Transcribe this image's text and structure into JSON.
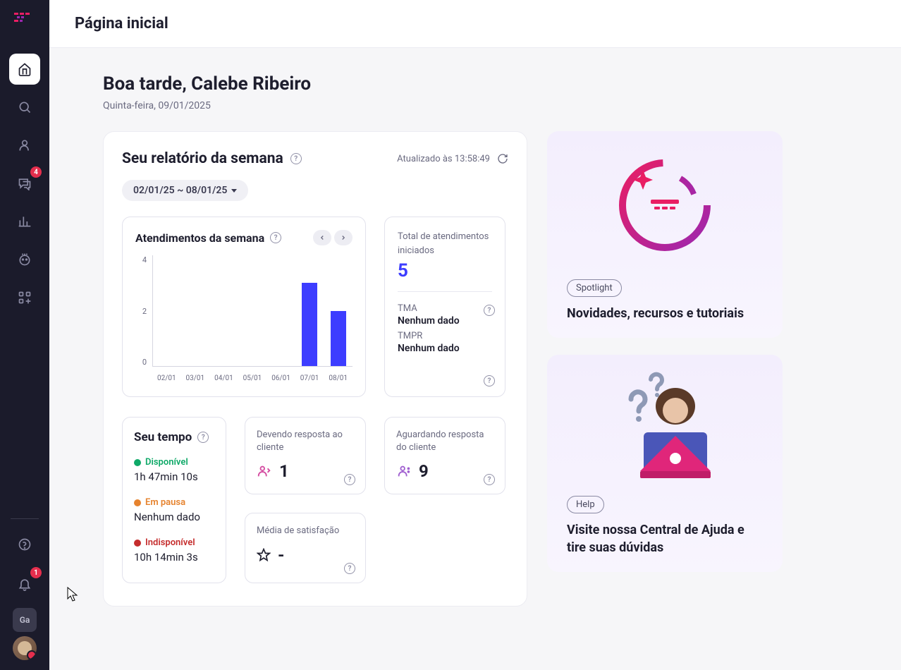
{
  "page_title": "Página inicial",
  "greeting": "Boa tarde, Calebe Ribeiro",
  "date": "Quinta-feira, 09/01/2025",
  "sidebar": {
    "badges": {
      "chat": "4",
      "bell": "1"
    },
    "avatar_sq": "Ga"
  },
  "report": {
    "title": "Seu relatório da semana",
    "updated": "Atualizado às 13:58:49",
    "date_range": "02/01/25 ~ 08/01/25"
  },
  "chart_card": {
    "title": "Atendimentos da semana"
  },
  "chart_data": {
    "type": "bar",
    "categories": [
      "02/01",
      "03/01",
      "04/01",
      "05/01",
      "06/01",
      "07/01",
      "08/01"
    ],
    "values": [
      0,
      0,
      0,
      0,
      0,
      3,
      2
    ],
    "title": "Atendimentos da semana",
    "xlabel": "",
    "ylabel": "",
    "ylim": [
      0,
      4
    ]
  },
  "totals": {
    "label": "Total de atendimentos iniciados",
    "value": "5",
    "tma_label": "TMA",
    "tma_value": "Nenhum dado",
    "tmpr_label": "TMPR",
    "tmpr_value": "Nenhum dado"
  },
  "time": {
    "title": "Seu tempo",
    "available_label": "Disponível",
    "available_value": "1h 47min 10s",
    "paused_label": "Em pausa",
    "paused_value": "Nenhum dado",
    "unavailable_label": "Indisponível",
    "unavailable_value": "10h 14min 3s"
  },
  "owed": {
    "label": "Devendo resposta ao cliente",
    "value": "1"
  },
  "waiting": {
    "label": "Aguardando resposta do cliente",
    "value": "9"
  },
  "satisfaction": {
    "label": "Média de satisfação",
    "value": "-"
  },
  "promo1": {
    "badge": "Spotlight",
    "title": "Novidades, recursos e tutoriais"
  },
  "promo2": {
    "badge": "Help",
    "title": "Visite nossa Central de Ajuda e tire suas dúvidas"
  }
}
